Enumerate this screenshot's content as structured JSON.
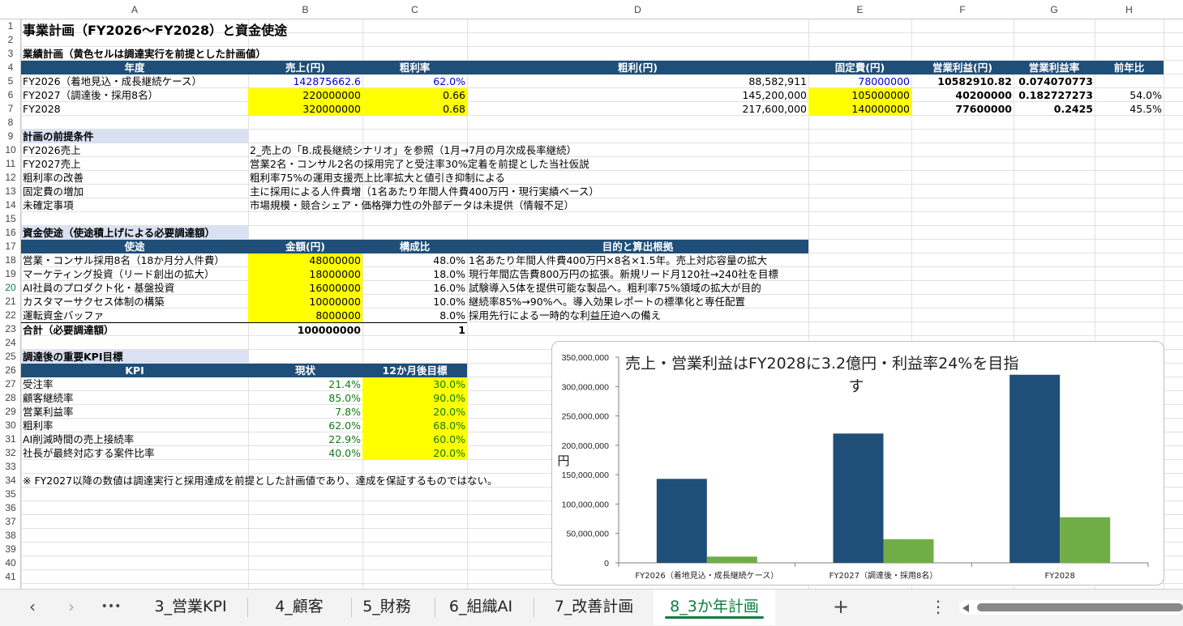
{
  "columns": [
    "A",
    "B",
    "C",
    "D",
    "E",
    "F",
    "G",
    "H"
  ],
  "rows": [
    "1",
    "2",
    "3",
    "4",
    "5",
    "6",
    "7",
    "8",
    "9",
    "10",
    "11",
    "12",
    "13",
    "14",
    "15",
    "16",
    "17",
    "18",
    "19",
    "20",
    "21",
    "22",
    "23",
    "24",
    "25",
    "26",
    "27",
    "28",
    "29",
    "30",
    "31",
    "32",
    "33",
    "34",
    "35",
    "36",
    "37",
    "38",
    "39",
    "40",
    "41"
  ],
  "title": "事業計画（FY2026〜FY2028）と資金使途",
  "plan": {
    "section": "業績計画（黄色セルは調達実行を前提とした計画値）",
    "headers": [
      "年度",
      "売上(円)",
      "粗利率",
      "粗利(円)",
      "固定費(円)",
      "営業利益(円)",
      "営業利益率",
      "前年比"
    ],
    "rows": [
      [
        "FY2026（着地見込・成長継続ケース）",
        "142875662.6",
        "62.0%",
        "88,582,911",
        "78000000",
        "10582910.82",
        "0.074070773",
        ""
      ],
      [
        "FY2027（調達後・採用8名）",
        "220000000",
        "0.66",
        "145,200,000",
        "105000000",
        "40200000",
        "0.182727273",
        "54.0%"
      ],
      [
        "FY2028",
        "320000000",
        "0.68",
        "217,600,000",
        "140000000",
        "77600000",
        "0.2425",
        "45.5%"
      ]
    ]
  },
  "premise": {
    "section": "計画の前提条件",
    "items": [
      {
        "label": "FY2026売上",
        "text": "2_売上の「B.成長継続シナリオ」を参照（1月→7月の月次成長率継続）"
      },
      {
        "label": "FY2027売上",
        "text": "営業2名・コンサル2名の採用完了と受注率30%定着を前提とした当社仮説"
      },
      {
        "label": "粗利率の改善",
        "text": "粗利率75%の運用支援売上比率拡大と値引き抑制による"
      },
      {
        "label": "固定費の増加",
        "text": "主に採用による人件費増（1名あたり年間人件費400万円・現行実績ベース）"
      },
      {
        "label": "未確定事項",
        "text": "市場規模・競合シェア・価格弾力性の外部データは未提供（情報不足）"
      }
    ]
  },
  "funds": {
    "section": "資金使途（使途積上げによる必要調達額）",
    "headers": [
      "使途",
      "金額(円)",
      "構成比",
      "目的と算出根拠"
    ],
    "rows": [
      [
        "営業・コンサル採用8名（18か月分人件費）",
        "48000000",
        "48.0%",
        "1名あたり年間人件費400万円×8名×1.5年。売上対応容量の拡大"
      ],
      [
        "マーケティング投資（リード創出の拡大）",
        "18000000",
        "18.0%",
        "現行年間広告費800万円の拡張。新規リード月120社→240社を目標"
      ],
      [
        "AI社員のプロダクト化・基盤投資",
        "16000000",
        "16.0%",
        "試験導入5体を提供可能な製品へ。粗利率75%領域の拡大が目的"
      ],
      [
        "カスタマーサクセス体制の構築",
        "10000000",
        "10.0%",
        "継続率85%→90%へ。導入効果レポートの標準化と専任配置"
      ],
      [
        "運転資金バッファ",
        "8000000",
        "8.0%",
        "採用先行による一時的な利益圧迫への備え"
      ]
    ],
    "total": [
      "合計（必要調達額）",
      "100000000",
      "1"
    ]
  },
  "kpi": {
    "section": "調達後の重要KPI目標",
    "headers": [
      "KPI",
      "現状",
      "12か月後目標"
    ],
    "rows": [
      [
        "受注率",
        "21.4%",
        "30.0%"
      ],
      [
        "顧客継続率",
        "85.0%",
        "90.0%"
      ],
      [
        "営業利益率",
        "7.8%",
        "20.0%"
      ],
      [
        "粗利率",
        "62.0%",
        "68.0%"
      ],
      [
        "AI削減時間の売上接続率",
        "22.9%",
        "60.0%"
      ],
      [
        "社長が最終対応する案件比率",
        "40.0%",
        "20.0%"
      ]
    ]
  },
  "note": "※ FY2027以降の数値は調達実行と採用達成を前提とした計画値であり、達成を保証するものではない。",
  "chart_data": {
    "type": "bar",
    "title": "売上・営業利益はFY2028に3.2億円・利益率24%を目指す",
    "title_line1": "売上・営業利益はFY2028に3.2億円・利益率24%を目指",
    "title_line2": "す",
    "ylabel": "円",
    "categories": [
      "FY2026（着地見込・成長継続ケース）",
      "FY2027（調達後・採用8名）",
      "FY2028"
    ],
    "series": [
      {
        "values": [
          142875663,
          220000000,
          320000000
        ],
        "color": "#1f4e78"
      },
      {
        "values": [
          10582911,
          40200000,
          77600000
        ],
        "color": "#70ad47"
      }
    ],
    "ylim": [
      0,
      350000000
    ],
    "yticks": [
      "0",
      "50,000,000",
      "100,000,000",
      "150,000,000",
      "200,000,000",
      "250,000,000",
      "300,000,000",
      "350,000,000"
    ],
    "grid": false
  },
  "tabs": {
    "prev_icon": "‹",
    "next_icon": "›",
    "more_icon": "•••",
    "items": [
      "3_営業KPI",
      "4_顧客",
      "5_財務",
      "6_組織AI",
      "7_改善計画",
      "8_3か年計画"
    ],
    "active": "8_3か年計画",
    "add_icon": "+",
    "options_icon": "⋮"
  }
}
